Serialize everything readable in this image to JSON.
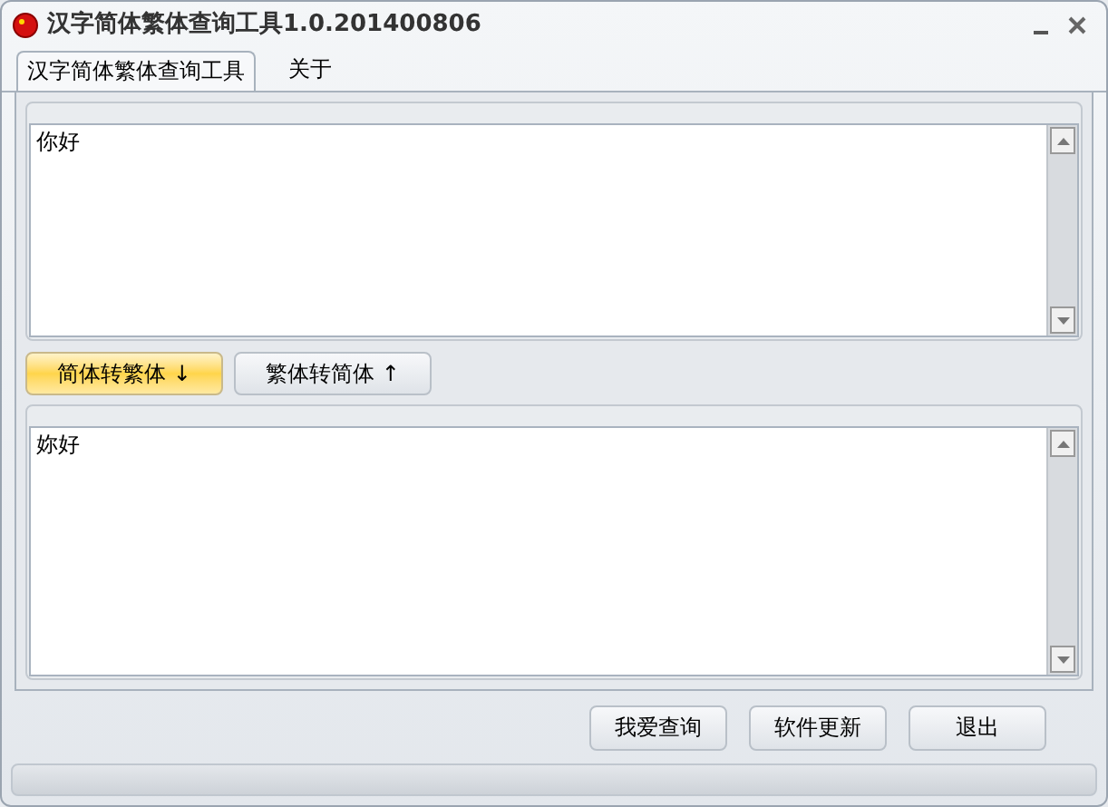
{
  "window": {
    "title": "汉字简体繁体查询工具1.0.201400806"
  },
  "tabs": [
    {
      "label": "汉字简体繁体查询工具",
      "selected": true
    },
    {
      "label": "关于",
      "selected": false
    }
  ],
  "input_text": {
    "value": "你好"
  },
  "convert_buttons": [
    {
      "label": "简体转繁体 ↓",
      "highlighted": true
    },
    {
      "label": "繁体转简体 ↑",
      "highlighted": false
    }
  ],
  "output_text": {
    "value": "妳好"
  },
  "footer_buttons": [
    "我爱查询",
    "软件更新",
    "退出"
  ]
}
